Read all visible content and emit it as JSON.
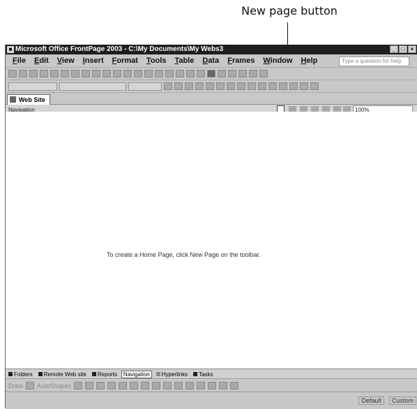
{
  "callout": {
    "label": "New page button"
  },
  "titlebar": {
    "title": "Microsoft Office FrontPage 2003 - C:\\My Documents\\My Webs3",
    "icon": "frontpage-icon"
  },
  "menubar": {
    "items": [
      "File",
      "Edit",
      "View",
      "Insert",
      "Format",
      "Tools",
      "Table",
      "Data",
      "Frames",
      "Window",
      "Help"
    ],
    "help_placeholder": "Type a question for help"
  },
  "tab": {
    "label": "Web Site"
  },
  "navbar": {
    "label": "Navigation",
    "zoom": "100%"
  },
  "content": {
    "message": "To create a Home Page, click New Page on the toolbar."
  },
  "view_tabs": [
    {
      "label": "Folders",
      "active": false
    },
    {
      "label": "Remote Web site",
      "active": false
    },
    {
      "label": "Reports",
      "active": false
    },
    {
      "label": "Navigation",
      "active": true
    },
    {
      "label": "Hyperlinks",
      "active": false
    },
    {
      "label": "Tasks",
      "active": false
    }
  ],
  "drawbar": {
    "draw": "Draw",
    "autoshapes": "AutoShapes"
  },
  "status": {
    "default": "Default",
    "custom": "Custom"
  }
}
